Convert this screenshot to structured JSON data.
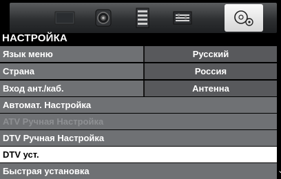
{
  "tabs": [
    {
      "icon": "picture-icon"
    },
    {
      "icon": "sound-icon"
    },
    {
      "icon": "channel-list-icon"
    },
    {
      "icon": "preferences-icon"
    },
    {
      "icon": "setup-icon",
      "active": true
    }
  ],
  "section_title": "НАСТРОЙКА",
  "rows": [
    {
      "label": "Язык меню",
      "value": "Русский"
    },
    {
      "label": "Страна",
      "value": "Россия"
    },
    {
      "label": "Вход ант./каб.",
      "value": "Антенна"
    },
    {
      "label": "Автомат. Настройка"
    },
    {
      "label": "ATV Ручная Настройка",
      "state": "disabled"
    },
    {
      "label": "DTV Ручная Настройка"
    },
    {
      "label": "DTV уст.",
      "state": "selected"
    },
    {
      "label": "Быстрая установка"
    }
  ],
  "scroll_indicator": "⌄",
  "colors": {
    "row_bg": "#6f7174",
    "value_bg": "#58595c",
    "selected_bg": "#ffffff",
    "disabled_text": "#8e9093"
  }
}
